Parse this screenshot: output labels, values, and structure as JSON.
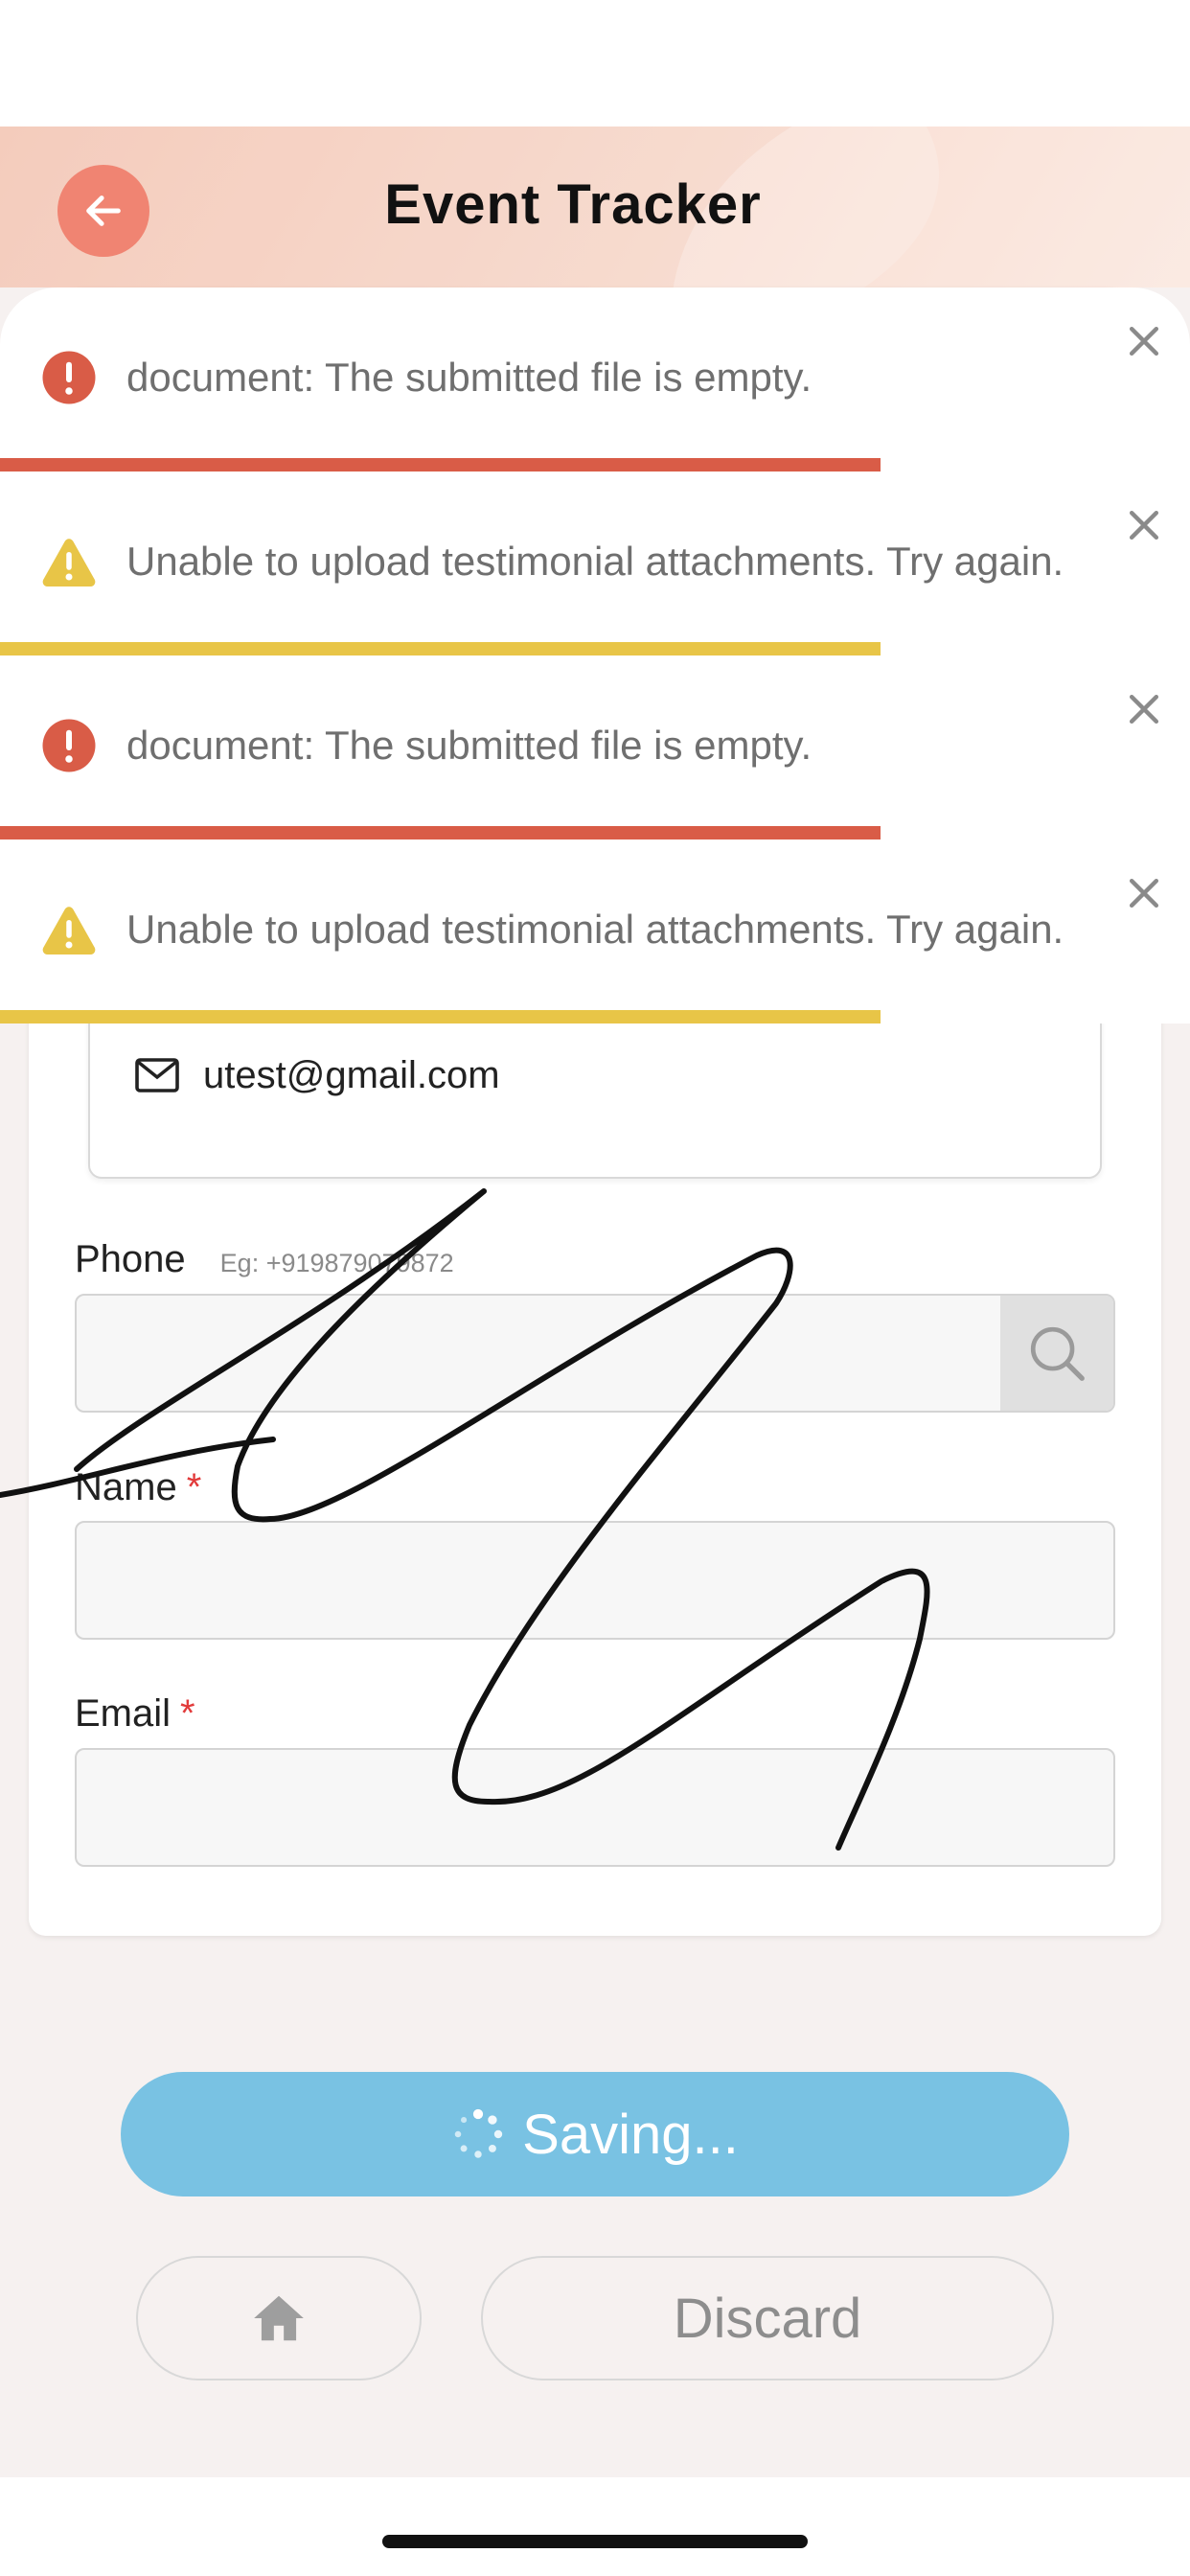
{
  "header": {
    "title": "Event Tracker",
    "back_icon": "arrow-left-icon"
  },
  "toasts": [
    {
      "type": "error",
      "icon": "error-circle-icon",
      "message": "document: The submitted file is empty.",
      "progress_percent": 74,
      "color": "#d95c47"
    },
    {
      "type": "warning",
      "icon": "warning-triangle-icon",
      "message": "Unable to upload testimonial attachments. Try again.",
      "progress_percent": 74,
      "color": "#e8c547"
    },
    {
      "type": "error",
      "icon": "error-circle-icon",
      "message": "document: The submitted file is empty.",
      "progress_percent": 74,
      "color": "#d95c47"
    },
    {
      "type": "warning",
      "icon": "warning-triangle-icon",
      "message": "Unable to upload testimonial attachments. Try again.",
      "progress_percent": 74,
      "color": "#e8c547"
    }
  ],
  "contact": {
    "email": "utest@gmail.com"
  },
  "form": {
    "phone_label": "Phone",
    "phone_hint": "Eg: +919879079872",
    "phone_value": "",
    "name_label": "Name",
    "name_value": "",
    "email_label": "Email",
    "email_value": "",
    "required_mark": "*"
  },
  "actions": {
    "save_label": "Saving...",
    "discard_label": "Discard"
  },
  "colors": {
    "accent": "#f08472",
    "save": "#79c2e3",
    "error": "#d95c47",
    "warning": "#e8c547",
    "required": "#e23b3b"
  }
}
